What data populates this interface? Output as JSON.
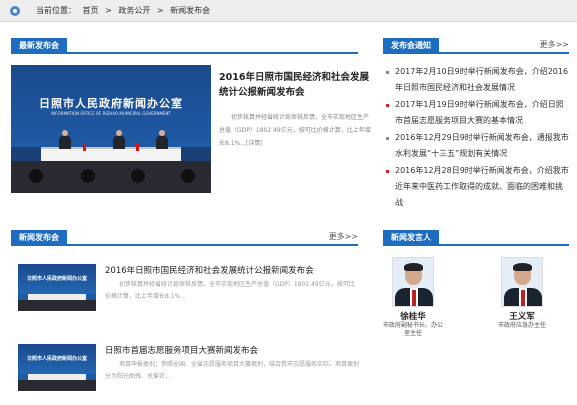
{
  "breadcrumb": {
    "label": "当前位置：",
    "items": [
      "首页",
      "政务公开",
      "新闻发布会"
    ],
    "separator": ">"
  },
  "latest": {
    "header": "最新发布会",
    "image": {
      "org_cn": "日照市人民政府新闻办公室",
      "org_en": "INFORMATION OFFICE OF RIZHAO MUNICIPAL GOVERNMENT"
    },
    "title": "2016年日照市国民经济和社会发展统计公报新闻发布会",
    "summary": "初步核算并经省统计局审核反馈，全市实现地区生产总值（GDP）1802.49亿元，按可比价格计算，比上年增长8.1%...[详情]"
  },
  "notices": {
    "header": "发布会通知",
    "more": "更多>>",
    "items": [
      {
        "text": "2017年2月10日9时举行新闻发布会，介绍2016年日照市国民经济和社会发展情况",
        "red": false
      },
      {
        "text": "2017年1月19日9时举行新闻发布会，介绍日照市首届志愿服务项目大赛的基本情况",
        "red": true
      },
      {
        "text": "2016年12月29日9时举行新闻发布会，通报我市水利发展“十三五”规划有关情况",
        "red": false
      },
      {
        "text": "2016年12月28日9时举行新闻发布会，介绍我市近年来中医药工作取得的成就、面临的困难和挑战",
        "red": true
      }
    ]
  },
  "news": {
    "header": "新闻发布会",
    "more": "更多>>",
    "items": [
      {
        "title": "2016年日照市国民经济和社会发展统计公报新闻发布会",
        "summary": "初步核算并经省统计局审核反馈，全市实现地区生产总值（GDP）1802.49亿元，按可比价格计算，比上年增长8.1%...",
        "thumb_text": "日照市人民政府新闻办公室"
      },
      {
        "title": "日照市首届志愿服务项目大赛新闻发布会",
        "summary": "项目申报类别：参照全国、全省志愿服务项目大赛类别，结合我市志愿服务实际，项目类别分为阳光助残、关爱农...",
        "thumb_text": "日照市人民政府新闻办公室"
      }
    ]
  },
  "spokespersons": {
    "header": "新闻发言人",
    "people": [
      {
        "name": "徐桂华",
        "role": "市政府副秘书长、办公室主任"
      },
      {
        "name": "王义军",
        "role": "市政府应急办主任"
      }
    ]
  },
  "colors": {
    "accent": "#1e6dc0",
    "notice_bullet_red": "#d02020",
    "crumb_bg": "#eeeeee"
  }
}
